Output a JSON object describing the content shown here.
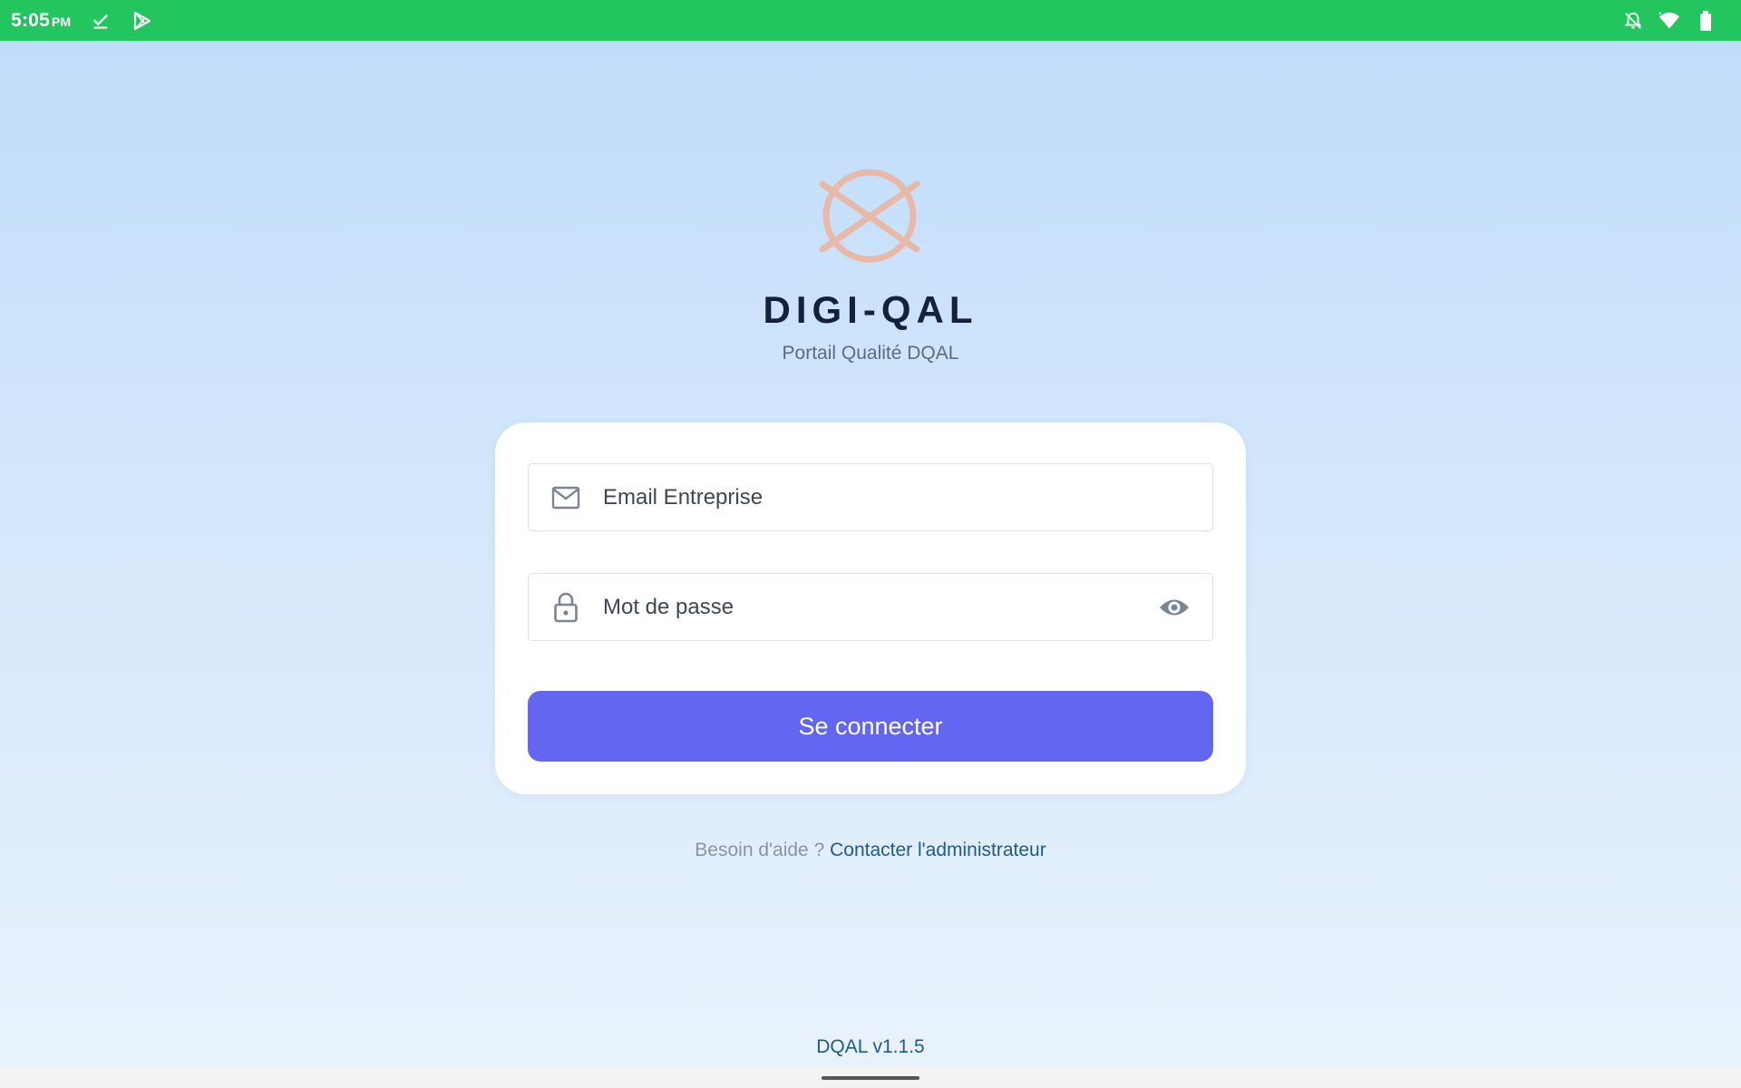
{
  "status_bar": {
    "time": "5:05",
    "ampm": "PM",
    "left_icons": [
      "download-done-icon",
      "play-store-icon"
    ],
    "right_icons": [
      "notifications-off-icon",
      "wifi-icon",
      "battery-icon"
    ],
    "color": "#22c55e"
  },
  "app": {
    "title": "DIGI-QAL",
    "subtitle": "Portail Qualité DQAL",
    "logo_icon": "circle-cross-logo"
  },
  "form": {
    "email": {
      "placeholder": "Email Entreprise",
      "value": "",
      "icon": "envelope-icon"
    },
    "password": {
      "placeholder": "Mot de passe",
      "value": "",
      "icon": "lock-icon",
      "toggle_icon": "eye-icon"
    },
    "submit_label": "Se connecter"
  },
  "help": {
    "text": "Besoin d'aide ?",
    "link": "Contacter l'administrateur"
  },
  "version": "DQAL v1.1.5",
  "colors": {
    "accent": "#6366f1",
    "link": "#1d5b8f",
    "logo": "#e8b9a6",
    "title": "#14213d"
  }
}
